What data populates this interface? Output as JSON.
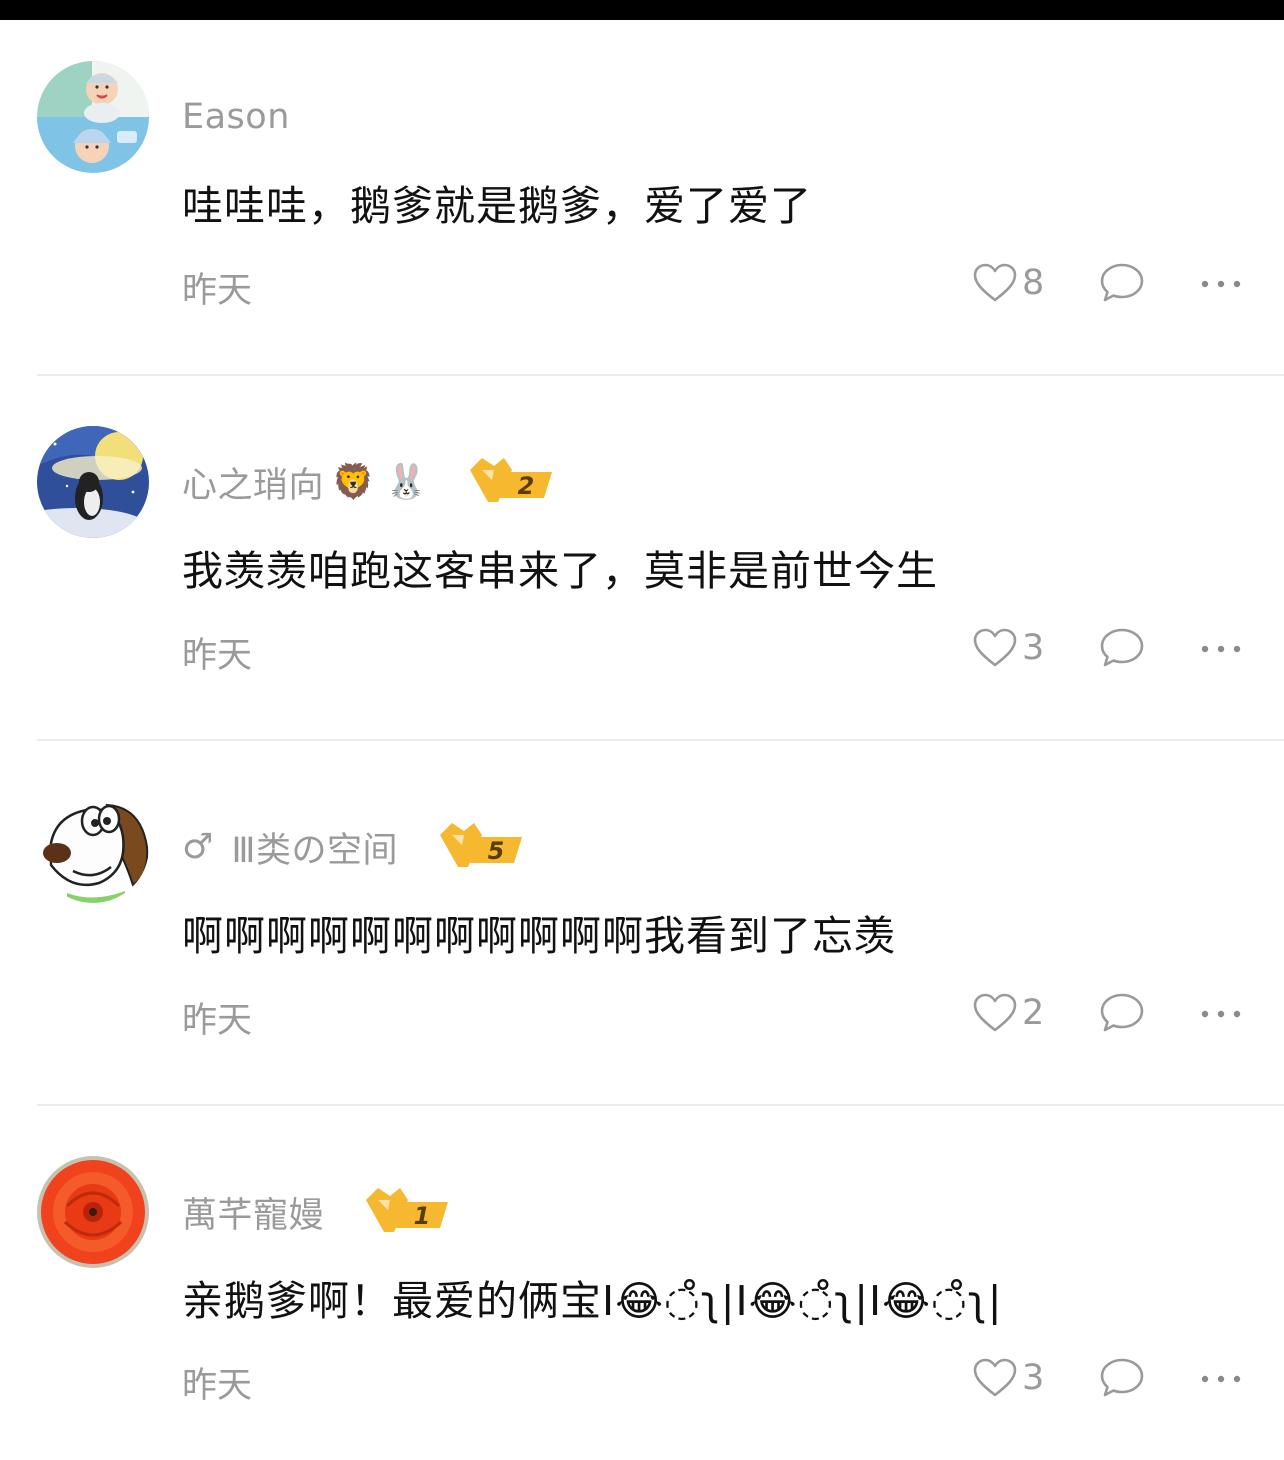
{
  "comments": [
    {
      "avatar": "baby-photo-avatar",
      "name": "Eason",
      "gender": "",
      "name_emoji": "",
      "vip_level": "",
      "text": "哇哇哇，鹅爹就是鹅爹，爱了爱了",
      "time": "昨天",
      "likes": "8"
    },
    {
      "avatar": "night-sky-penguin-avatar",
      "name": "心之琑向",
      "gender": "",
      "name_emoji": "🦁 🐰",
      "vip_level": "2",
      "text": "我羡羡咱跑这客串来了，莫非是前世今生",
      "time": "昨天",
      "likes": "3"
    },
    {
      "avatar": "cartoon-dog-avatar",
      "name": "Ⅲ类の空间",
      "gender": "♂",
      "name_emoji": "",
      "vip_level": "5",
      "text": "啊啊啊啊啊啊啊啊啊啊啊我看到了忘羡",
      "time": "昨天",
      "likes": "2"
    },
    {
      "avatar": "orange-flower-avatar",
      "name": "萬芊寵嫚",
      "gender": "",
      "name_emoji": "",
      "vip_level": "1",
      "text": "亲鹅爹啊！最爱的俩宝Ι😂◌̊ʅ|Ι😂◌̊ʅ|Ι😂◌̊ʅ|",
      "time": "昨天",
      "likes": "3"
    }
  ],
  "colors": {
    "secondary_text": "#9a9a9a",
    "primary_text": "#111111",
    "vip_gold": "#f5b82e",
    "divider": "#ececec",
    "top_bar": "#000000"
  }
}
